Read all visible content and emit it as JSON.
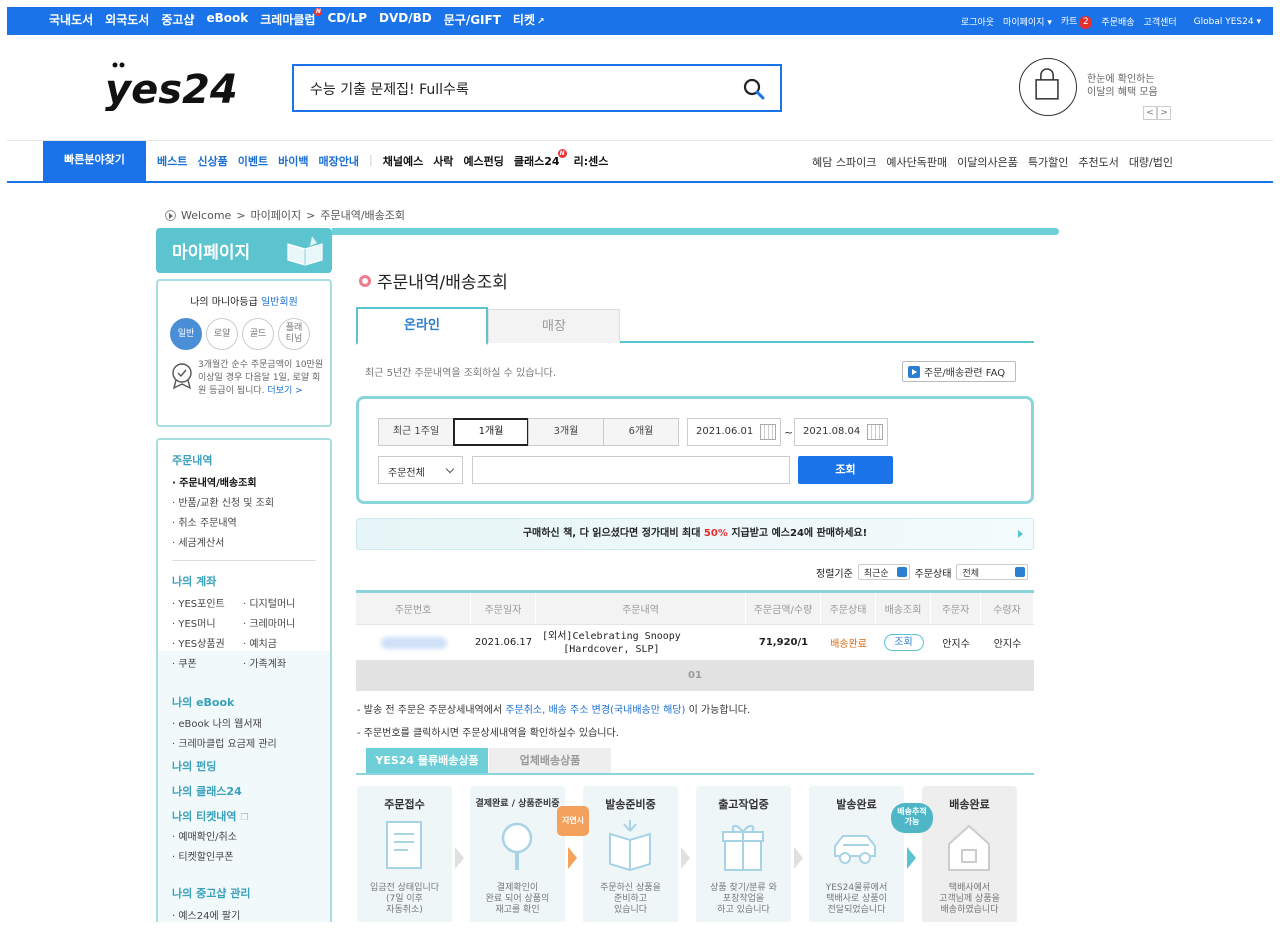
{
  "top_bar": {
    "categories": [
      "국내도서",
      "외국도서",
      "중고샵",
      "eBook",
      "크레마클럽",
      "CD/LP",
      "DVD/BD",
      "문구/GIFT",
      "티켓"
    ],
    "new_badge": "N",
    "logout": "로그아웃",
    "mypage": "마이페이지",
    "cart": "카트",
    "cart_count": "2",
    "order_delivery": "주문배송",
    "customer_center": "고객센터",
    "global": "Global YES24"
  },
  "header": {
    "search_text": "수능 기출 문제집! Full수록",
    "benefit_line1": "한눈에 확인하는",
    "benefit_line2": "이달의 혜택 모음",
    "prev": "<",
    "next": ">"
  },
  "gnb": {
    "quick": "빠른분야찾기",
    "left_blue": [
      "베스트",
      "신상품",
      "이벤트",
      "바이백",
      "매장안내"
    ],
    "left_dark": [
      "채널예스",
      "사락",
      "예스펀딩",
      "클래스24",
      "리:센스"
    ],
    "new_badge": "N",
    "right": [
      "혜담 스파이크",
      "예사단독판매",
      "이달의사은품",
      "특가할인",
      "추천도서",
      "대량/법인"
    ]
  },
  "breadcrumb": {
    "items": [
      "Welcome",
      ">",
      "마이페이지",
      ">",
      "주문내역/배송조회"
    ]
  },
  "sidebar": {
    "title": "마이페이지",
    "grade_label": "나의 마니아등급",
    "grade_value": "일반회원",
    "grades": [
      "일반",
      "로얄",
      "골드",
      "플래\n티넘"
    ],
    "grade_desc": "3개월간 순수 주문금액이 10만원 이상일 경우 다음달 1일, 로얄 회원 등급이 됩니다.",
    "more": "더보기 >",
    "sections": {
      "orders": {
        "head": "주문내역",
        "items": [
          "주문내역/배송조회",
          "반품/교환 신청 및 조회",
          "취소 주문내역",
          "세금계산서"
        ]
      },
      "account": {
        "head": "나의 계좌",
        "left": [
          "YES포인트",
          "YES머니",
          "YES상품권",
          "쿠폰"
        ],
        "right": [
          "디지털머니",
          "크레마머니",
          "예치금",
          "가족계좌"
        ]
      },
      "ebook": {
        "head": "나의 eBook",
        "items": [
          "eBook 나의 웹서재",
          "크레마클럽 요금제 관리"
        ]
      },
      "funding": {
        "head": "나의 펀딩"
      },
      "class": {
        "head": "나의 클래스24"
      },
      "ticket": {
        "head": "나의 티켓내역",
        "items": [
          "예매확인/취소",
          "티켓할인쿠폰"
        ]
      },
      "used": {
        "head": "나의 중고샵 관리",
        "items": [
          "예스24에 팔기"
        ]
      }
    }
  },
  "main": {
    "title": "주문내역/배송조회",
    "tabs": [
      "온라인",
      "매장"
    ],
    "period_note": "최근 5년간 주문내역을 조회하실 수 있습니다.",
    "faq": "주문/배송관련 FAQ",
    "periods": [
      "최근 1주일",
      "1개월",
      "3개월",
      "6개월"
    ],
    "date_from": "2021.06.01",
    "date_to": "2021.08.04",
    "tilde": "~",
    "state": "주문전체",
    "search_btn": "조회",
    "promo_prefix": "구매하신 책, 다 읽으셨다면 정가대비 최대 ",
    "promo_pct": "50%",
    "promo_suffix": " 지급받고 예스24에 판매하세요!",
    "sort_label": "정렬기준",
    "sort_value": "최근순",
    "status_label": "주문상태",
    "status_value": "전체",
    "table": {
      "headers": [
        "주문번호",
        "주문일자",
        "주문내역",
        "주문금액/수량",
        "주문상태",
        "배송조회",
        "주문자",
        "수령자"
      ],
      "rows": [
        {
          "date": "2021.06.17",
          "title_line1": "[외서]Celebrating Snoopy",
          "title_line2": "[Hardcover, SLP]",
          "amount": "71,920/1",
          "status": "배송완료",
          "track": "조회",
          "orderer": "안지수",
          "receiver": "안지수"
        }
      ],
      "page": "01"
    },
    "note1_prefix": "- 발송 전 주문은 주문상세내역에서 ",
    "note1_link": "주문취소, 배송 주소 변경(국내배송만 해당)",
    "note1_suffix": " 이 가능합니다.",
    "note2": "- 주문번호를 클릭하시면 주문상세내역을 확인하실수 있습니다.",
    "flow_tabs": [
      "YES24 물류배송상품",
      "업체배송상품"
    ],
    "steps": [
      {
        "title": "주문접수",
        "desc": "입금전 상태입니다\n(7일 이후\n자동취소)"
      },
      {
        "title": "결제완료 / 상품준비중",
        "desc": "결제확인이\n완료 되어 상품의\n재고를 확인"
      },
      {
        "title": "발송준비중",
        "desc": "주문하신 상품을\n준비하고\n있습니다"
      },
      {
        "title": "출고작업중",
        "desc": "상품 찾기/분류 와\n포장작업을\n하고 있습니다"
      },
      {
        "title": "발송완료",
        "desc": "YES24물류에서\n택배사로 상품이\n전달되었습니다"
      },
      {
        "title": "배송완료",
        "desc": "택배사에서\n고객님께 상품을\n배송하였습니다"
      }
    ],
    "tag_delay": "지연시",
    "tag_track": "배송추적\n가능"
  }
}
